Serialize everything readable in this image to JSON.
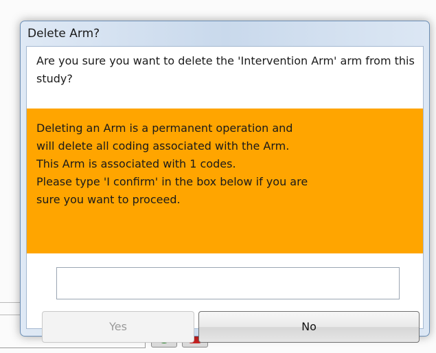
{
  "dialog": {
    "title": "Delete Arm?",
    "question": "Are you sure you want to delete the 'Intervention Arm' arm from this study?",
    "warning_lines": [
      "Deleting an Arm is a permanent operation and",
      "will delete all coding associated with the Arm.",
      "This Arm is associated with 1 codes.",
      "Please type 'I confirm' in the box below if you are",
      "sure you want to proceed."
    ],
    "confirm_input": {
      "value": "",
      "placeholder": ""
    },
    "yes_label": "Yes",
    "no_label": "No"
  },
  "colors": {
    "warning_bg": "#ffa500",
    "dialog_frame": "#c9d9ec"
  }
}
